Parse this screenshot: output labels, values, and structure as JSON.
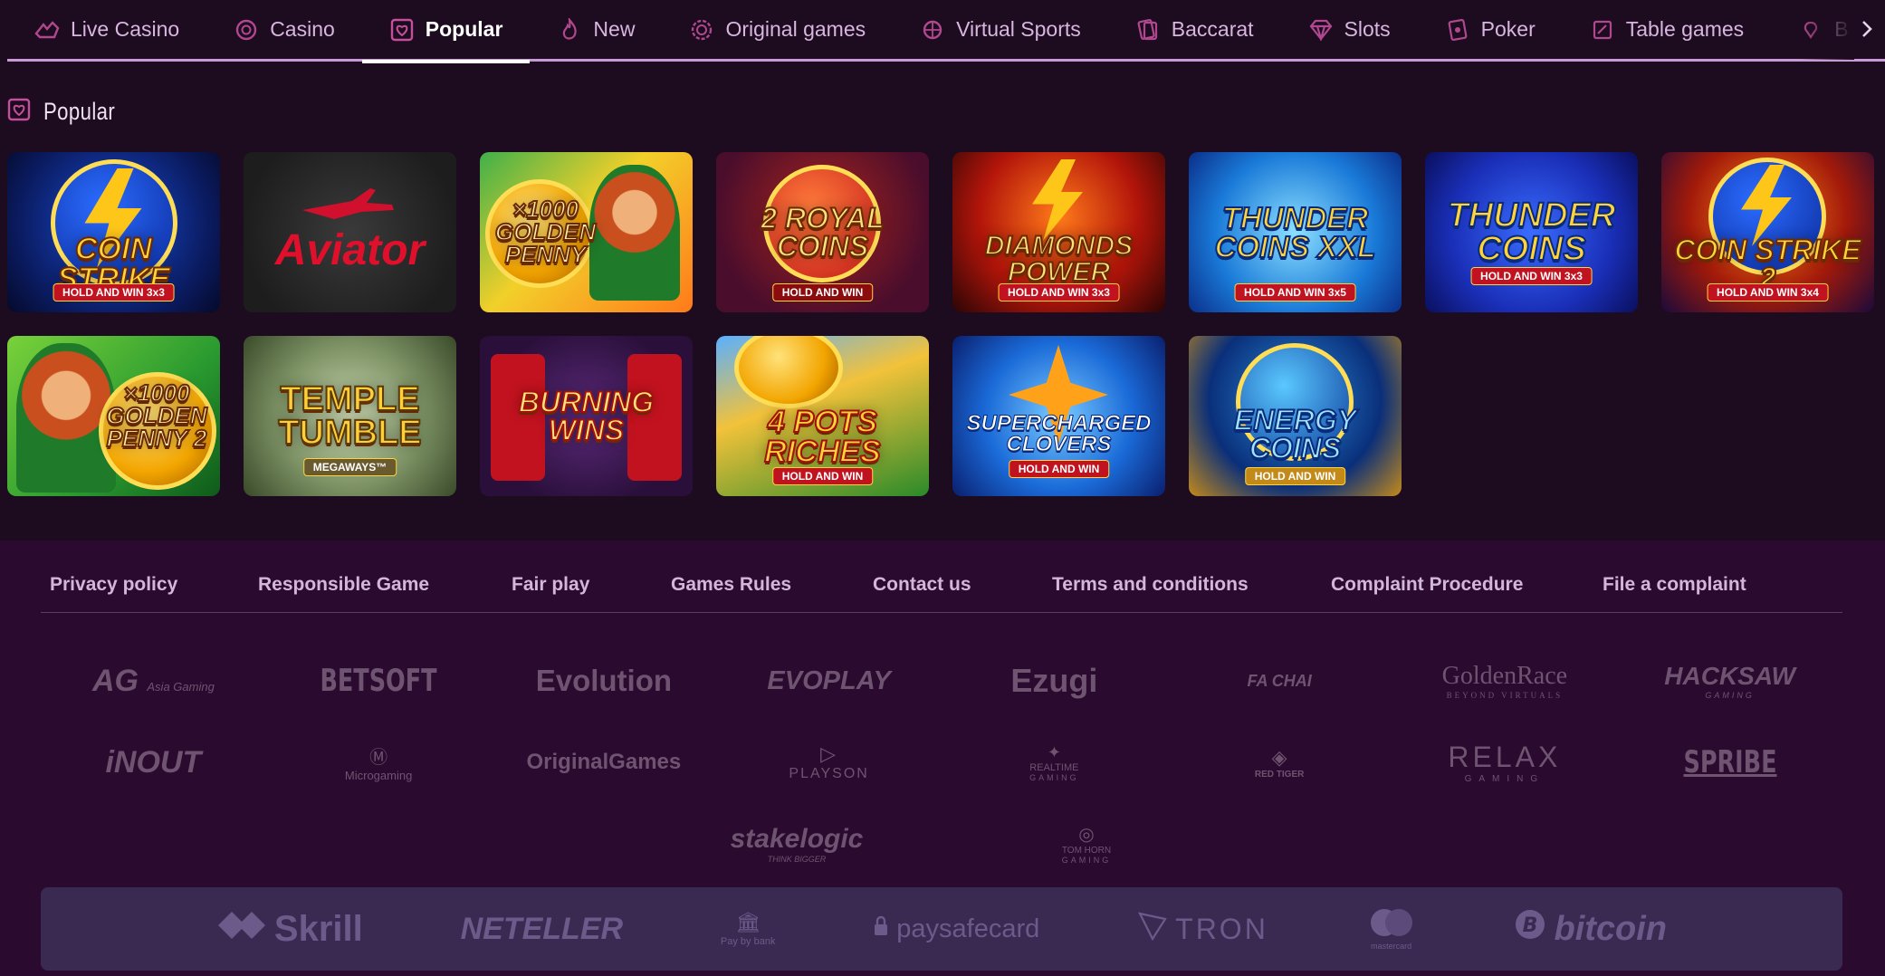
{
  "nav": {
    "items": [
      {
        "label": "Live Casino",
        "icon": "live-casino-icon"
      },
      {
        "label": "Casino",
        "icon": "casino-chip-icon"
      },
      {
        "label": "Popular",
        "icon": "popular-heart-icon",
        "active": true
      },
      {
        "label": "New",
        "icon": "flame-icon"
      },
      {
        "label": "Original games",
        "icon": "original-games-icon"
      },
      {
        "label": "Virtual Sports",
        "icon": "virtual-sports-icon"
      },
      {
        "label": "Baccarat",
        "icon": "baccarat-cards-icon"
      },
      {
        "label": "Slots",
        "icon": "diamond-icon"
      },
      {
        "label": "Poker",
        "icon": "poker-cards-icon"
      },
      {
        "label": "Table games",
        "icon": "table-games-icon"
      },
      {
        "label": "B",
        "icon": "partial-icon"
      }
    ],
    "next_icon": "chevron-right-icon"
  },
  "section": {
    "title": "Popular",
    "icon": "popular-heart-icon"
  },
  "games": [
    {
      "title": "Coin Strike",
      "sub": "HOLD AND WIN 3x3"
    },
    {
      "title": "Aviator",
      "sub": ""
    },
    {
      "title": "×1000 Golden Penny",
      "sub": ""
    },
    {
      "title": "2 Royal Coins",
      "sub": "HOLD AND WIN"
    },
    {
      "title": "Diamonds Power",
      "sub": "HOLD AND WIN 3x3"
    },
    {
      "title": "Thunder Coins XXL",
      "sub": "HOLD AND WIN 3x5"
    },
    {
      "title": "Thunder Coins",
      "sub": "HOLD AND WIN 3x3"
    },
    {
      "title": "Coin Strike 2",
      "sub": "HOLD AND WIN 3x4"
    },
    {
      "title": "×1000 Golden Penny 2",
      "sub": ""
    },
    {
      "title": "Temple Tumble",
      "sub": "MEGAWAYS™"
    },
    {
      "title": "Burning Wins",
      "sub": ""
    },
    {
      "title": "4 Pots Riches",
      "sub": "HOLD AND WIN"
    },
    {
      "title": "Supercharged Clovers",
      "sub": "HOLD AND WIN"
    },
    {
      "title": "Energy Coins",
      "sub": "HOLD AND WIN"
    }
  ],
  "footer": {
    "links": [
      "Privacy policy",
      "Responsible Game",
      "Fair play",
      "Games Rules",
      "Contact us",
      "Terms and conditions",
      "Complaint Procedure",
      "File a complaint"
    ],
    "providers_row1": [
      {
        "name": "AG",
        "tag": "Asia Gaming"
      },
      {
        "name": "BETSOFT",
        "tag": ""
      },
      {
        "name": "Evolution",
        "tag": ""
      },
      {
        "name": "EVOPLAY",
        "tag": ""
      },
      {
        "name": "Ezugi",
        "tag": ""
      },
      {
        "name": "FA CHAI",
        "tag": ""
      },
      {
        "name": "GoldenRace",
        "tag": "BEYOND VIRTUALS"
      },
      {
        "name": "HACKSAW",
        "tag": "GAMING"
      }
    ],
    "providers_row2": [
      {
        "name": "iNOUT",
        "tag": ""
      },
      {
        "name": "Microgaming",
        "tag": ""
      },
      {
        "name": "OriginalGames",
        "tag": ""
      },
      {
        "name": "PLAYSON",
        "tag": ""
      },
      {
        "name": "REALTIME",
        "tag": "GAMING"
      },
      {
        "name": "RED TIGER",
        "tag": ""
      },
      {
        "name": "RELAX",
        "tag": "GAMING"
      },
      {
        "name": "SPRIBE",
        "tag": ""
      }
    ],
    "providers_row3": [
      {
        "name": "stakelogic",
        "tag": "THINK BIGGER"
      },
      {
        "name": "TOM HORN",
        "tag": "GAMING"
      }
    ],
    "payments": [
      {
        "name": "Skrill",
        "icon": "skrill-icon"
      },
      {
        "name": "NETELLER",
        "icon": ""
      },
      {
        "name": "Pay by bank",
        "icon": "bank-icon"
      },
      {
        "name": "paysafecard",
        "icon": "lock-icon"
      },
      {
        "name": "TRON",
        "icon": "tron-icon"
      },
      {
        "name": "mastercard",
        "icon": "mastercard-icon"
      },
      {
        "name": "bitcoin",
        "icon": "bitcoin-icon"
      }
    ]
  },
  "colors": {
    "background": "#1d0b1f",
    "footer": "#2a0a2e",
    "nav_text": "#d7b6df",
    "accent": "#c79ad6",
    "payments_bar": "#3a2a52"
  }
}
